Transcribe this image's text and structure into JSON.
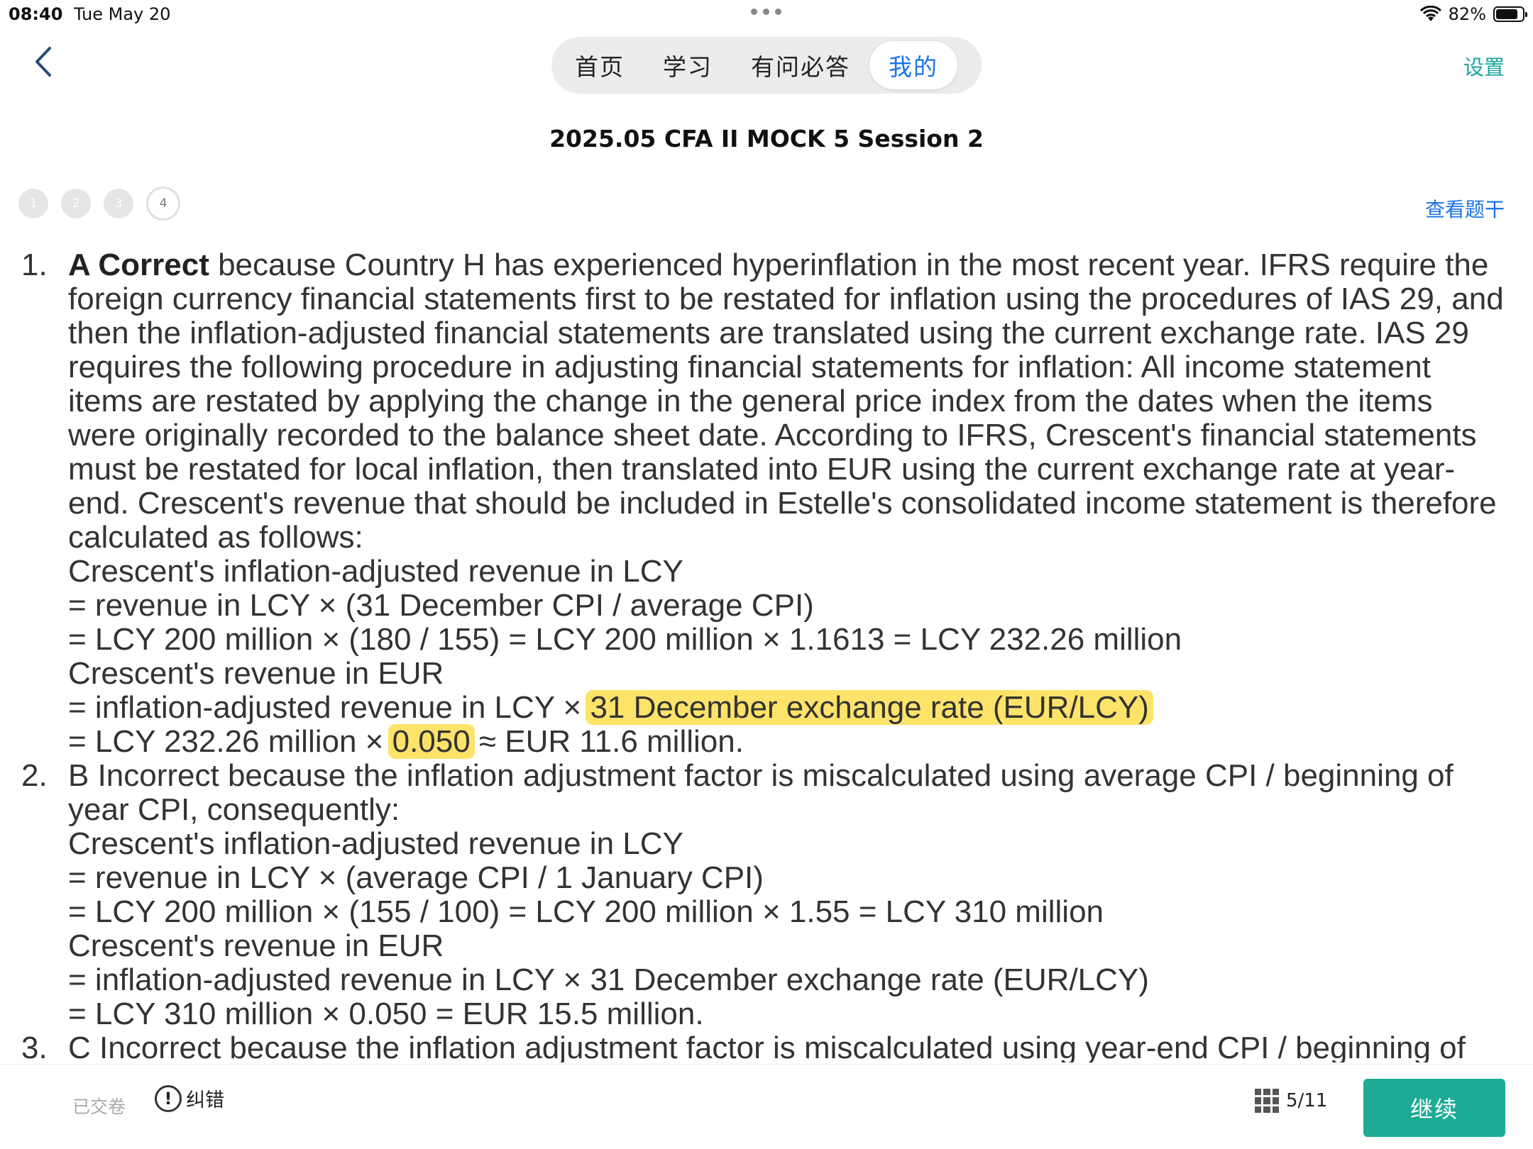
{
  "status": {
    "time": "08:40",
    "date": "Tue May 20",
    "battery": "82%",
    "battery_level": 0.82,
    "wifi_icon": "wifi-icon"
  },
  "nav": {
    "back_icon": "chevron-left-icon",
    "tabs": [
      {
        "label": "首页"
      },
      {
        "label": "学习"
      },
      {
        "label": "有问必答"
      },
      {
        "label": "我的"
      }
    ],
    "active_tab": "我的",
    "settings_label": "设置"
  },
  "title": "2025.05 CFA II MOCK 5 Session 2",
  "progress": {
    "dots": [
      "1",
      "2",
      "3",
      "4"
    ],
    "current": "4",
    "view_stem_label": "查看题干"
  },
  "explanation": {
    "items": [
      {
        "num": "1.",
        "lead": "A Correct",
        "lines": [
          " because Country H has experienced hyperinflation in the most recent year. IFRS require the",
          "foreign currency financial statements first to be restated for inflation using the procedures of IAS 29, and",
          "then the inflation-adjusted financial statements are translated using the current exchange rate. IAS 29",
          "requires the following procedure in adjusting financial statements for inflation: All income statement",
          "items are restated by applying the change in the general price index from the dates when the items",
          "were originally recorded to the balance sheet date. According to IFRS, Crescent's financial statements",
          "must be restated for local inflation, then translated into EUR using the current exchange rate at year-",
          "end. Crescent's revenue that should be included in Estelle's consolidated income statement is therefore",
          "calculated as follows:",
          "Crescent's inflation-adjusted revenue in LCY",
          "= revenue in LCY × (31 December CPI / average CPI)",
          "= LCY 200 million × (180 / 155) = LCY 200 million × 1.1613 = LCY 232.26 million",
          "Crescent's revenue in EUR"
        ],
        "hl_line_a_pre": "= inflation-adjusted revenue in LCY × ",
        "hl_line_a_mark": "31 December exchange rate (EUR/LCY)",
        "hl_line_b_pre": "= LCY 232.26 million × ",
        "hl_line_b_mark": "0.050",
        "hl_line_b_post": " ≈ EUR 11.6 million."
      },
      {
        "num": "2.",
        "lines": [
          "B Incorrect because the inflation adjustment factor is miscalculated using average CPI / beginning of",
          "year CPI, consequently:",
          "Crescent's inflation-adjusted revenue in LCY",
          "= revenue in LCY × (average CPI / 1 January CPI)",
          "= LCY 200 million × (155 / 100) = LCY 200 million × 1.55 = LCY 310 million",
          "Crescent's revenue in EUR",
          "= inflation-adjusted revenue in LCY × 31 December exchange rate (EUR/LCY)",
          "= LCY 310 million × 0.050 = EUR 15.5 million."
        ]
      },
      {
        "num": "3.",
        "lines": [
          "C Incorrect because the inflation adjustment factor is miscalculated using year-end CPI / beginning of"
        ]
      }
    ]
  },
  "bottom": {
    "submitted_label": "已交卷",
    "report_label": "纠错",
    "report_icon": "exclamation-circle-icon",
    "grid_icon": "grid-icon",
    "page_counter": "5/11",
    "continue_label": "继续"
  }
}
